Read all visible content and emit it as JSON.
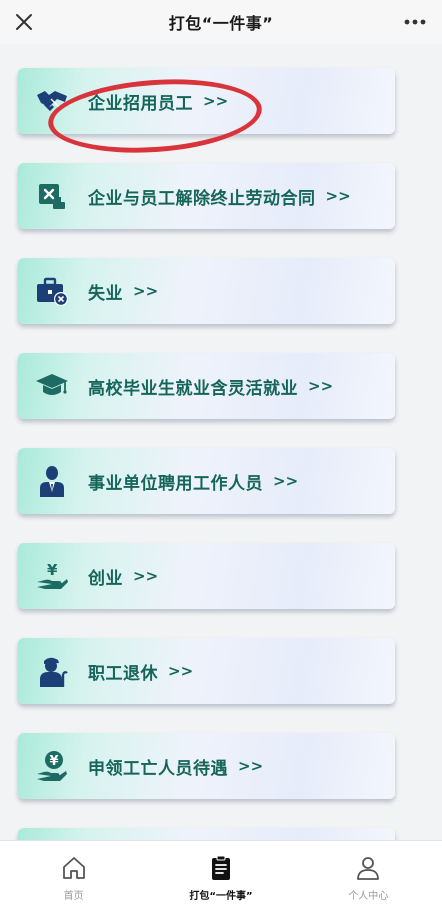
{
  "header": {
    "title": "打包“一件事”",
    "close_icon": "close-icon",
    "more_icon": "more-icon"
  },
  "items": [
    {
      "label": "企业招用员工",
      "arrow": ">>",
      "icon": "handshake-icon"
    },
    {
      "label": "企业与员工解除终止劳动合同",
      "arrow": ">>",
      "icon": "terminate-contract-icon"
    },
    {
      "label": "失业",
      "arrow": ">>",
      "icon": "briefcase-x-icon"
    },
    {
      "label": "高校毕业生就业含灵活就业",
      "arrow": ">>",
      "icon": "graduation-cap-icon"
    },
    {
      "label": "事业单位聘用工作人员",
      "arrow": ">>",
      "icon": "employee-icon"
    },
    {
      "label": "创业",
      "arrow": ">>",
      "icon": "hand-money-icon"
    },
    {
      "label": "职工退休",
      "arrow": ">>",
      "icon": "retiree-icon"
    },
    {
      "label": "申领工亡人员待遇",
      "arrow": ">>",
      "icon": "benefit-hand-icon"
    }
  ],
  "tabs": [
    {
      "label": "首页",
      "icon": "home-icon",
      "active": false
    },
    {
      "label": "打包“一件事”",
      "icon": "clipboard-icon",
      "active": true
    },
    {
      "label": "个人中心",
      "icon": "user-icon",
      "active": false
    }
  ],
  "colors": {
    "accent_text": "#15655a",
    "icon_blue": "#1d3f78",
    "annotation_red": "#d9343c"
  }
}
